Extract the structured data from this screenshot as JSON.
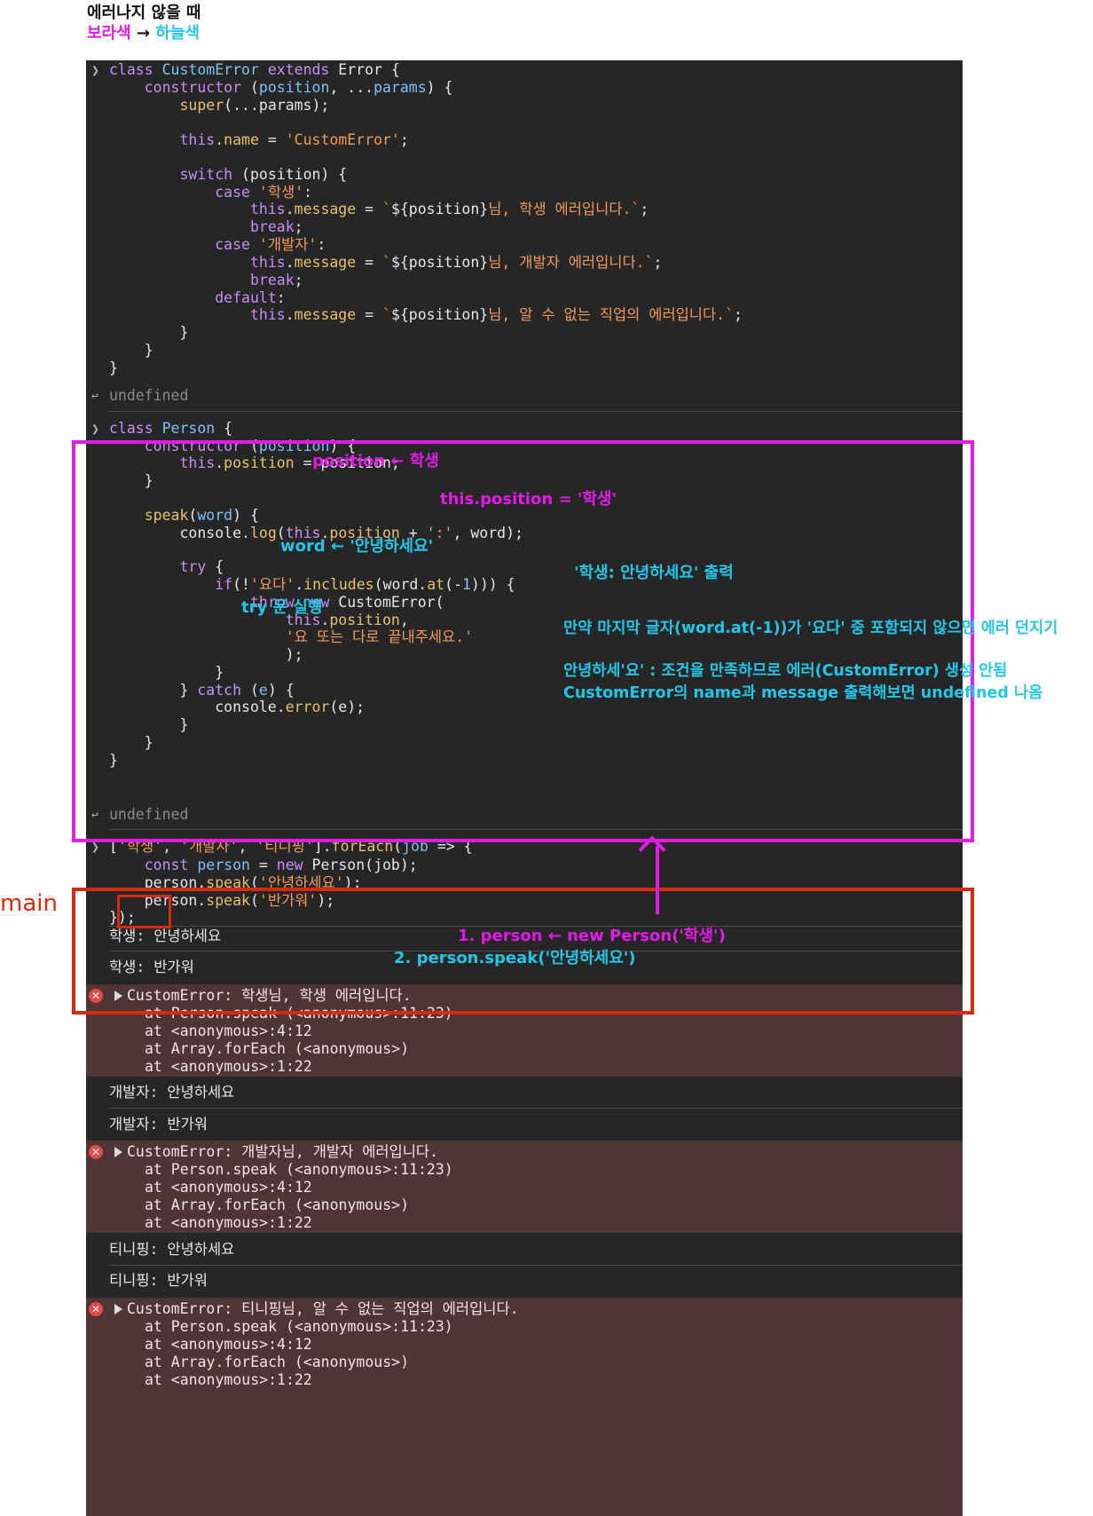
{
  "header": {
    "title": "에러나지 않을 때",
    "purple_label": "보라색",
    "arrow": "→",
    "cyan_label": "하늘색"
  },
  "blocks": {
    "custom_error": [
      [
        "class ",
        "CustomError",
        " extends ",
        "Error {"
      ],
      [
        "constructor (position, ...params) {"
      ],
      [
        "super(...params);"
      ],
      [
        ""
      ],
      [
        "this.name = 'CustomError';"
      ],
      [
        ""
      ],
      [
        "switch (position) {"
      ],
      [
        "case '학생':"
      ],
      [
        "this.message = `${position}님, 학생 에러입니다.`;"
      ],
      [
        "break;"
      ],
      [
        "case '개발자':"
      ],
      [
        "this.message = `${position}님, 개발자 에러입니다.`;"
      ],
      [
        "break;"
      ],
      [
        "default:"
      ],
      [
        "this.message = `${position}님, 알 수 없는 직업의 에러입니다.`;"
      ],
      [
        "}"
      ],
      [
        "}"
      ],
      [
        "}"
      ]
    ],
    "undefined_label": "undefined"
  },
  "outputs": {
    "s1": "학생: 안녕하세요",
    "s2": "학생: 반가워",
    "err1": [
      "CustomError: 학생님, 학생 에러입니다.",
      "at Person.speak (<anonymous>:11:23)",
      "at <anonymous>:4:12",
      "at Array.forEach (<anonymous>)",
      "at <anonymous>:1:22"
    ],
    "d1": "개발자: 안녕하세요",
    "d2": "개발자: 반가워",
    "err2": [
      "CustomError: 개발자님, 개발자 에러입니다.",
      "at Person.speak (<anonymous>:11:23)",
      "at <anonymous>:4:12",
      "at Array.forEach (<anonymous>)",
      "at <anonymous>:1:22"
    ],
    "t1": "티니핑: 안녕하세요",
    "t2": "티니핑: 반가워",
    "err3": [
      "CustomError: 티니핑님, 알 수 없는 직업의 에러입니다.",
      "at Person.speak (<anonymous>:11:23)",
      "at <anonymous>:4:12",
      "at Array.forEach (<anonymous>)",
      "at <anonymous>:1:22"
    ]
  },
  "annotations": {
    "pos_arrow": "position ← 학생",
    "this_pos": "this.position = '학생'",
    "word": "word ← '안녕하세요'",
    "print": "'학생: 안녕하세요' 출력",
    "try": "try 문 실행",
    "if_desc": "만약 마지막 글자(word.at(-1))가 '요다' 중 포함되지 않으면 에러 던지기",
    "cond1": "안녕하세'요' : 조건을 만족하므로 에러(CustomError) 생성 안됨",
    "cond2": "CustomError의 name과 message 출력해보면 undefined 나옴",
    "main_label": "main",
    "person": "1. person ← new Person('학생')",
    "speak": "2. person.speak('안녕하세요')"
  },
  "colors": {
    "purple": "#e21be8",
    "cyan": "#22c7e8",
    "red": "#d82a10",
    "console_bg": "#262626",
    "error_bg": "#4f3535"
  }
}
